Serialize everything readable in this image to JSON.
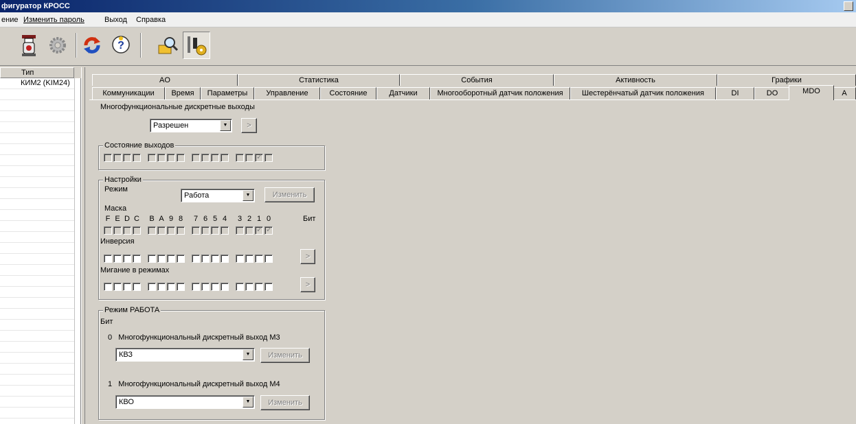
{
  "window": {
    "title": "фигуратор КРОСС"
  },
  "menu": [
    "ение",
    "Изменить пароль",
    "Выход",
    "Справка"
  ],
  "toolbar": {
    "buttons": [
      {
        "name": "device-icon"
      },
      {
        "name": "settings-gear-icon"
      },
      {
        "name": "refresh-icon"
      },
      {
        "name": "help-icon"
      },
      {
        "name": "search-tool-icon"
      },
      {
        "name": "tools-icon",
        "pressed": true
      }
    ]
  },
  "device_list": {
    "header": "Тип",
    "rows": [
      "КИМ2 (KIM24)"
    ]
  },
  "tabs": {
    "top": [
      "AO",
      "Статистика",
      "События",
      "Активность",
      "Графики"
    ],
    "bottom": [
      "Коммуникации",
      "Время",
      "Параметры",
      "Управление",
      "Состояние",
      "Датчики",
      "Многооборотный датчик положения",
      "Шестерёнчатый датчик положения",
      "DI",
      "DO",
      "MDO",
      "A"
    ],
    "active": "MDO"
  },
  "mdo": {
    "section_title": "Многофункциональные дискретные выходы",
    "enable_value": "Разрешен",
    "apply_arrow": ">",
    "outputs_state": {
      "title": "Состояние выходов",
      "checked": [
        false,
        false,
        false,
        false,
        false,
        false,
        false,
        false,
        false,
        false,
        false,
        false,
        false,
        false,
        true,
        false
      ]
    },
    "settings": {
      "title": "Настройки",
      "mode_label": "Режим",
      "mode_value": "Работа",
      "change_label": "Изменить",
      "mask_label": "Маска",
      "bit_letters": [
        "F",
        "E",
        "D",
        "C",
        "B",
        "A",
        "9",
        "8",
        "7",
        "6",
        "5",
        "4",
        "3",
        "2",
        "1",
        "0"
      ],
      "bit_word": "Бит",
      "mask_checked": [
        false,
        false,
        false,
        false,
        false,
        false,
        false,
        false,
        false,
        false,
        false,
        false,
        false,
        false,
        true,
        true
      ],
      "inversion_label": "Инверсия",
      "inversion_checked": [
        false,
        false,
        false,
        false,
        false,
        false,
        false,
        false,
        false,
        false,
        false,
        false,
        false,
        false,
        false,
        false
      ],
      "blink_label": "Мигание в режимах",
      "blink_checked": [
        false,
        false,
        false,
        false,
        false,
        false,
        false,
        false,
        false,
        false,
        false,
        false,
        false,
        false,
        false,
        false
      ]
    },
    "work_mode": {
      "title": "Режим РАБОТА",
      "bit_label": "Бит",
      "out0_label": "0   Многофункциональный дискретный выход М3",
      "out0_value": "КВЗ",
      "out1_label": "1   Многофункциональный дискретный выход М4",
      "out1_value": "КВО",
      "change_label": "Изменить"
    }
  }
}
